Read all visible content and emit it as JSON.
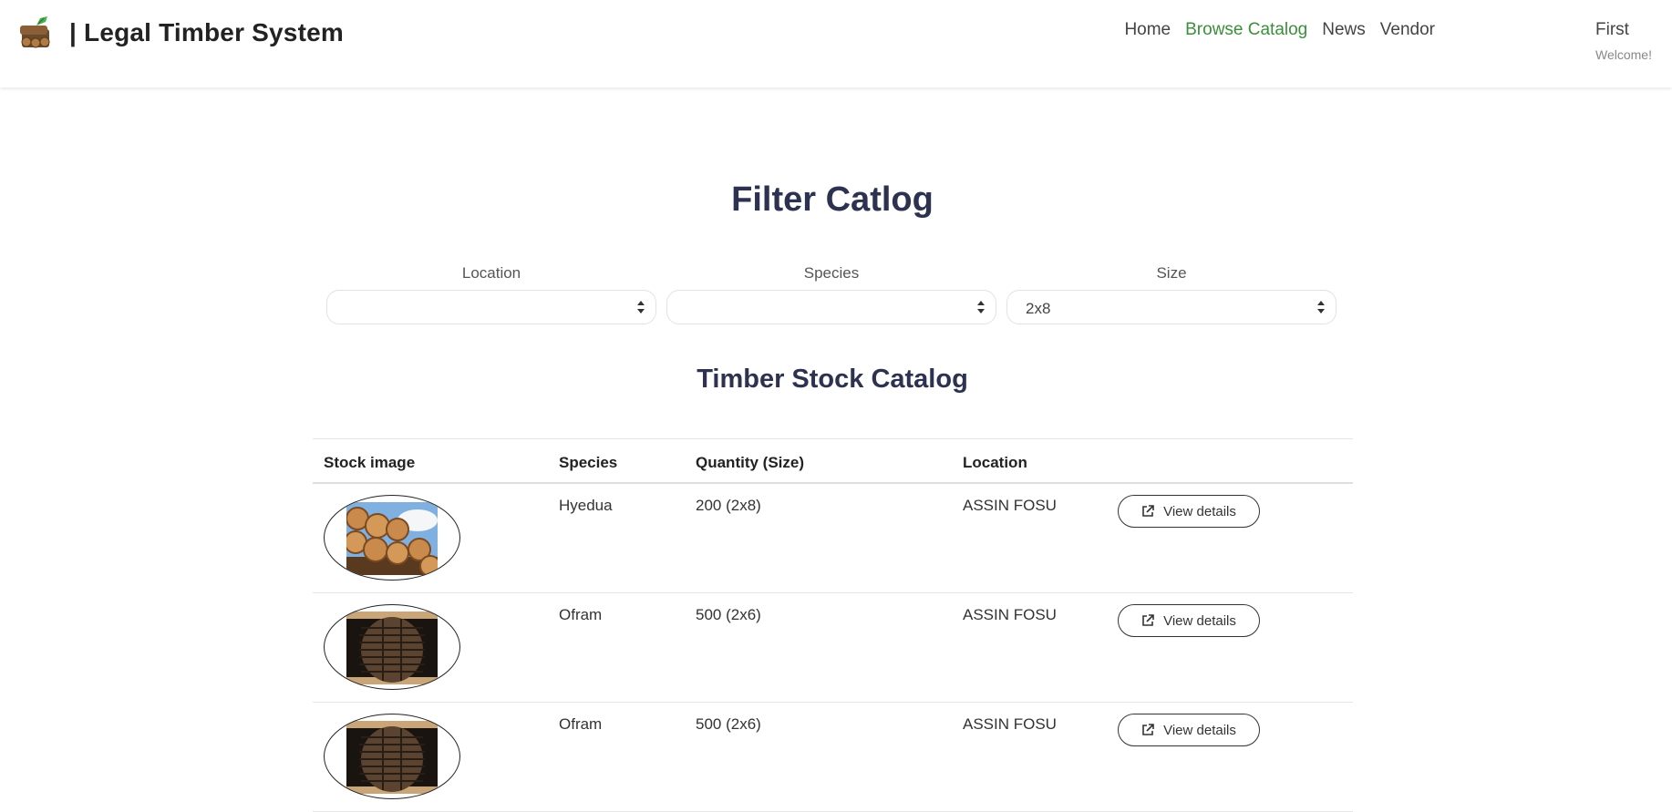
{
  "header": {
    "brand_title": "| Legal Timber System",
    "logo_icon": "timber-logo-icon",
    "nav": [
      {
        "label": "Home",
        "active": false
      },
      {
        "label": "Browse Catalog",
        "active": true
      },
      {
        "label": "News",
        "active": false
      },
      {
        "label": "Vendor",
        "active": false
      }
    ],
    "user": {
      "name": "First",
      "welcome": "Welcome!"
    },
    "accent_color": "#3b8e3b"
  },
  "filter": {
    "title": "Filter Catlog",
    "location": {
      "label": "Location",
      "value": ""
    },
    "species": {
      "label": "Species",
      "value": ""
    },
    "size": {
      "label": "Size",
      "value": "2x8"
    }
  },
  "catalog": {
    "title": "Timber Stock Catalog",
    "columns": [
      "Stock image",
      "Species",
      "Quantity (Size)",
      "Location"
    ],
    "button_label": "View details",
    "button_icon": "external-link-icon",
    "rows": [
      {
        "image": "log-pile-icon",
        "species": "Hyedua",
        "quantity": "200 (2x8)",
        "location": "ASSIN FOSU"
      },
      {
        "image": "log-stack-icon",
        "species": "Ofram",
        "quantity": "500 (2x6)",
        "location": "ASSIN FOSU"
      },
      {
        "image": "log-stack-icon",
        "species": "Ofram",
        "quantity": "500 (2x6)",
        "location": "ASSIN FOSU"
      }
    ]
  },
  "title_color": "#2c3250"
}
